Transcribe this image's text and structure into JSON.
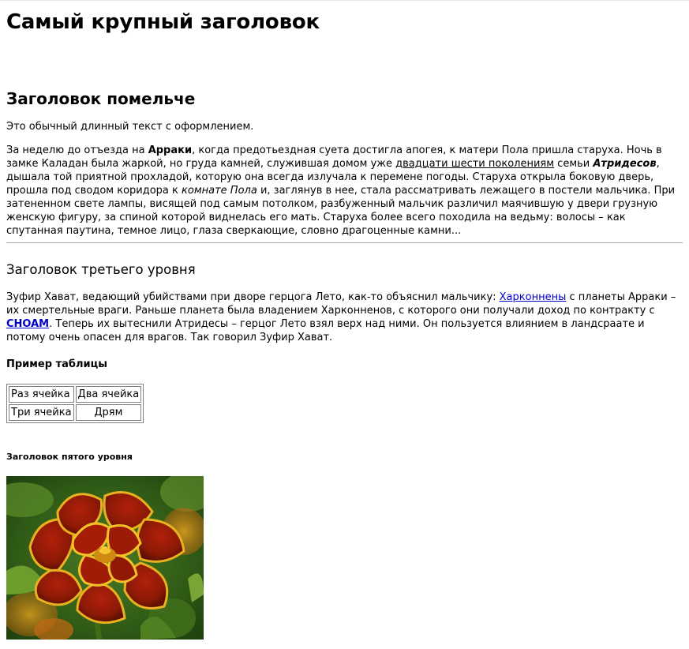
{
  "headings": {
    "h1": "Самый крупный заголовок",
    "h2": "Заголовок помельче",
    "h3": "Заголовок третьего уровня",
    "h4": "Пример таблицы",
    "h5": "Заголовок пятого уровня"
  },
  "paragraph1": "Это обычный длинный текст с оформлением.",
  "paragraph2": {
    "t1": "За неделю до отъезда на ",
    "b1": "Арраки",
    "t2": ", когда предотьездная суета достигла апогея, к матери Пола пришла старуха. Ночь в замке Каладан была жаркой, но груда камней, служившая домом уже ",
    "link1": "двадцати шести поколениям",
    "t3": " семьи ",
    "bi1": "Атридесов",
    "t4": ", дышала той приятной прохладой, которую она всегда излучала к перемене погоды. Старуха открыла боковую дверь, прошла под сводом коридора к ",
    "i1": "комнате Пола",
    "t5": " и, заглянув в нее, стала рассматривать лежащего в постели мальчика. При затененном свете лампы, висящей под самым потолком, разбуженный мальчик различил маячившую у двери грузную женскую фигуру, за спиной которой виднелась его мать. Старуха более всего походила на ведьму: волосы – как спутанная паутина, темное лицо, глаза сверкающие, словно драгоценные камни..."
  },
  "paragraph3": {
    "t1": "Зуфир Хават, ведающий убийствами при дворе герцога Лето, как-то объяснил мальчику: ",
    "link1": "Харконнены",
    "t2": " с планеты Арраки – их смертельные враги. Раньше планета была владением Харконненов, с которого они получали доход по контракту с ",
    "link2": "CHOAM",
    "t3": ". Теперь их вытеснили Атридесы – герцог Лето взял верх над ними. Он пользуется влиянием в ландсраате и потому очень опасен для врагов. Так говорил Зуфир Хават."
  },
  "table": {
    "rows": [
      [
        "Раз ячейка",
        "Два ячейка"
      ],
      [
        "Три ячейка",
        "Дрям"
      ]
    ]
  },
  "colors": {
    "link": "#0000cc",
    "rule": "#a8a8a8",
    "table_border": "#808080"
  },
  "image": {
    "icon": "marigold-flower-photo"
  }
}
